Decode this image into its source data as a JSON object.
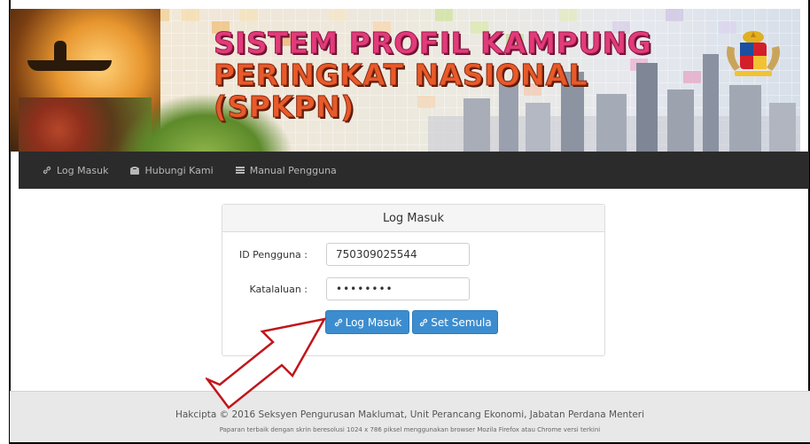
{
  "banner": {
    "title_line1": "SISTEM PROFIL KAMPUNG",
    "title_line2": "PERINGKAT NASIONAL",
    "title_line3": "(SPKPN)",
    "crest_icon": "coat-of-arms-icon"
  },
  "nav": {
    "items": [
      {
        "label": "Log Masuk",
        "icon": "link-icon"
      },
      {
        "label": "Hubungi Kami",
        "icon": "phone-icon"
      },
      {
        "label": "Manual Pengguna",
        "icon": "list-icon"
      }
    ]
  },
  "login": {
    "title": "Log Masuk",
    "username_label": "ID Pengguna :",
    "username_value": "750309025544",
    "password_label": "Katalaluan :",
    "password_value": "••••••••",
    "login_button": "Log Masuk",
    "reset_button": "Set Semula"
  },
  "footer": {
    "copyright": "Hakcipta © 2016 Seksyen Pengurusan Maklumat, Unit Perancang Ekonomi, Jabatan Perdana Menteri",
    "note": "Paparan terbaik dengan skrin beresolusi 1024 x 786 piksel menggunakan browser Mozila Firefox atau Chrome versi terkini"
  },
  "colors": {
    "navbar": "#2b2b2b",
    "button": "#3c8dcf",
    "arrow": "#c0161b"
  }
}
